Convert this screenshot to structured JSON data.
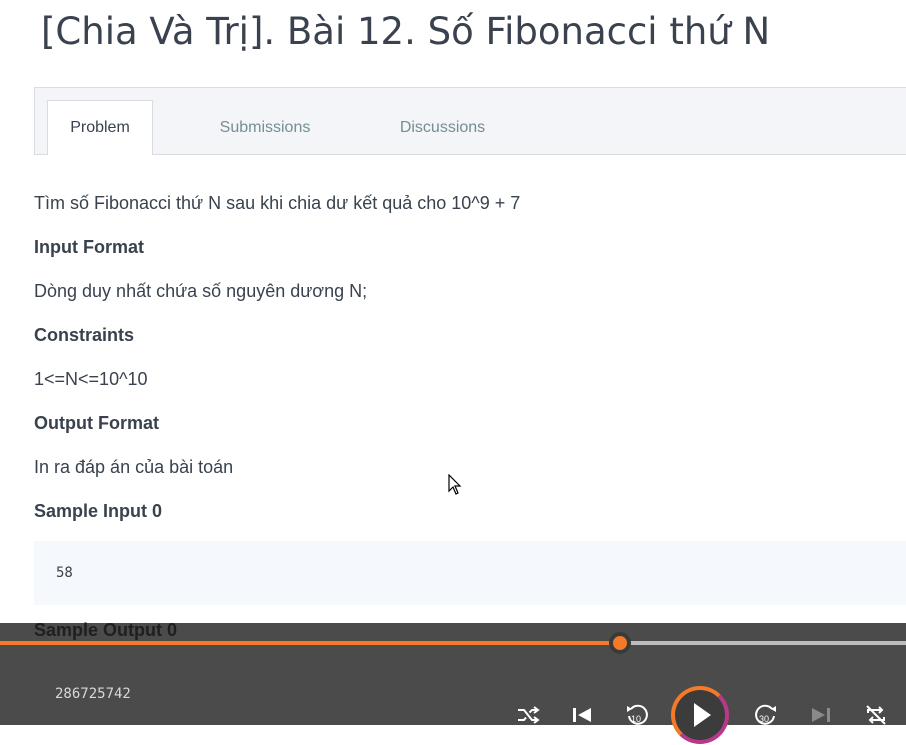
{
  "page": {
    "title": "[Chia Và Trị]. Bài 12. Số Fibonacci thứ N"
  },
  "tabs": [
    {
      "label": "Problem",
      "active": true
    },
    {
      "label": "Submissions",
      "active": false
    },
    {
      "label": "Discussions",
      "active": false
    }
  ],
  "problem": {
    "statement": "Tìm số Fibonacci thứ N sau khi chia dư kết quả cho 10^9 + 7",
    "input_heading": "Input Format",
    "input_text": "Dòng duy nhất chứa số nguyên dương N;",
    "constraints_heading": "Constraints",
    "constraints_text": "1<=N<=10^10",
    "output_heading": "Output Format",
    "output_text": "In ra đáp án của bài toán",
    "sample_input_heading": "Sample Input 0",
    "sample_input_value": "58",
    "sample_output_heading": "Sample Output 0",
    "sample_output_value": "286725742"
  },
  "player": {
    "progress": 0.684,
    "accent_color": "#f47a2a",
    "controls": [
      "shuffle-icon",
      "skip-previous-icon",
      "rewind-10-icon",
      "play-icon",
      "forward-30-icon",
      "skip-next-icon",
      "repeat-off-icon"
    ],
    "rewind_label": "10",
    "forward_label": "30"
  }
}
